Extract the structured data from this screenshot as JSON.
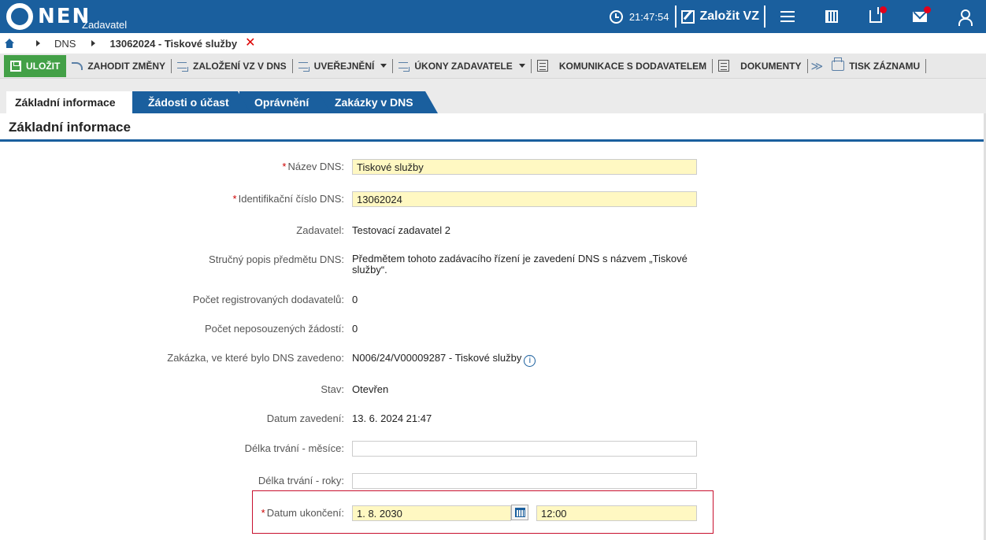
{
  "header": {
    "logo_text": "NEN",
    "logo_sub": "Zadavatel",
    "time": "21:47:54",
    "create_label": "Založit VZ"
  },
  "breadcrumb": {
    "items": [
      "DNS",
      "13062024 - Tiskové služby"
    ]
  },
  "toolbar": {
    "save": "ULOŽIT",
    "discard": "ZAHODIT ZMĚNY",
    "create_vz": "ZALOŽENÍ VZ V DNS",
    "publish": "UVEŘEJNĚNÍ",
    "actions": "ÚKONY ZADAVATELE",
    "communication": "KOMUNIKACE S DODAVATELEM",
    "documents": "DOKUMENTY",
    "print": "TISK ZÁZNAMU"
  },
  "tabs": [
    {
      "label": "Základní informace",
      "active": true
    },
    {
      "label": "Žádosti o účast",
      "active": false
    },
    {
      "label": "Oprávnění",
      "active": false
    },
    {
      "label": "Zakázky v DNS",
      "active": false
    }
  ],
  "section_title": "Základní informace",
  "form": {
    "name": {
      "label": "Název DNS:",
      "value": "Tiskové služby"
    },
    "id": {
      "label": "Identifikační číslo DNS:",
      "value": "13062024"
    },
    "contracting": {
      "label": "Zadavatel:",
      "value": "Testovací zadavatel 2"
    },
    "description": {
      "label": "Stručný popis předmětu DNS:",
      "value_line1": "Předmětem tohoto zadávacího řízení je zavedení DNS s názvem „Tiskové",
      "value_line2": "služby“."
    },
    "registered": {
      "label": "Počet registrovaných dodavatelů:",
      "value": "0"
    },
    "pending": {
      "label": "Počet neposouzených žádostí:",
      "value": "0"
    },
    "contract": {
      "label": "Zakázka, ve které bylo DNS zavedeno:",
      "value": "N006/24/V00009287 - Tiskové služby"
    },
    "state": {
      "label": "Stav:",
      "value": "Otevřen"
    },
    "established": {
      "label": "Datum zavedení:",
      "value": "13. 6. 2024 21:47"
    },
    "months": {
      "label": "Délka trvání - měsíce:",
      "value": ""
    },
    "years": {
      "label": "Délka trvání - roky:",
      "value": ""
    },
    "end_date": {
      "label": "Datum ukončení:",
      "date": "1. 8. 2030",
      "time": "12:00"
    }
  },
  "required_mark": "*",
  "info_glyph": "i",
  "colors": {
    "brand": "#1a5f9e",
    "save": "#43a047",
    "required": "#c00",
    "highlight": "#c8102e",
    "field_yellow": "#fff8c2"
  }
}
